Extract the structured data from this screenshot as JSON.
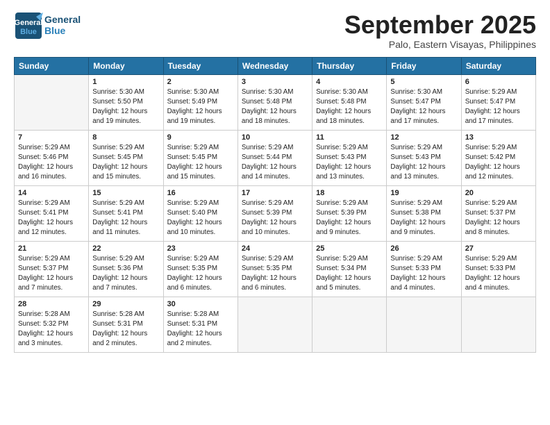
{
  "header": {
    "logo_line1": "General",
    "logo_line2": "Blue",
    "month": "September 2025",
    "location": "Palo, Eastern Visayas, Philippines"
  },
  "weekdays": [
    "Sunday",
    "Monday",
    "Tuesday",
    "Wednesday",
    "Thursday",
    "Friday",
    "Saturday"
  ],
  "weeks": [
    [
      {
        "day": "",
        "info": ""
      },
      {
        "day": "1",
        "info": "Sunrise: 5:30 AM\nSunset: 5:50 PM\nDaylight: 12 hours\nand 19 minutes."
      },
      {
        "day": "2",
        "info": "Sunrise: 5:30 AM\nSunset: 5:49 PM\nDaylight: 12 hours\nand 19 minutes."
      },
      {
        "day": "3",
        "info": "Sunrise: 5:30 AM\nSunset: 5:48 PM\nDaylight: 12 hours\nand 18 minutes."
      },
      {
        "day": "4",
        "info": "Sunrise: 5:30 AM\nSunset: 5:48 PM\nDaylight: 12 hours\nand 18 minutes."
      },
      {
        "day": "5",
        "info": "Sunrise: 5:30 AM\nSunset: 5:47 PM\nDaylight: 12 hours\nand 17 minutes."
      },
      {
        "day": "6",
        "info": "Sunrise: 5:29 AM\nSunset: 5:47 PM\nDaylight: 12 hours\nand 17 minutes."
      }
    ],
    [
      {
        "day": "7",
        "info": "Sunrise: 5:29 AM\nSunset: 5:46 PM\nDaylight: 12 hours\nand 16 minutes."
      },
      {
        "day": "8",
        "info": "Sunrise: 5:29 AM\nSunset: 5:45 PM\nDaylight: 12 hours\nand 15 minutes."
      },
      {
        "day": "9",
        "info": "Sunrise: 5:29 AM\nSunset: 5:45 PM\nDaylight: 12 hours\nand 15 minutes."
      },
      {
        "day": "10",
        "info": "Sunrise: 5:29 AM\nSunset: 5:44 PM\nDaylight: 12 hours\nand 14 minutes."
      },
      {
        "day": "11",
        "info": "Sunrise: 5:29 AM\nSunset: 5:43 PM\nDaylight: 12 hours\nand 13 minutes."
      },
      {
        "day": "12",
        "info": "Sunrise: 5:29 AM\nSunset: 5:43 PM\nDaylight: 12 hours\nand 13 minutes."
      },
      {
        "day": "13",
        "info": "Sunrise: 5:29 AM\nSunset: 5:42 PM\nDaylight: 12 hours\nand 12 minutes."
      }
    ],
    [
      {
        "day": "14",
        "info": "Sunrise: 5:29 AM\nSunset: 5:41 PM\nDaylight: 12 hours\nand 12 minutes."
      },
      {
        "day": "15",
        "info": "Sunrise: 5:29 AM\nSunset: 5:41 PM\nDaylight: 12 hours\nand 11 minutes."
      },
      {
        "day": "16",
        "info": "Sunrise: 5:29 AM\nSunset: 5:40 PM\nDaylight: 12 hours\nand 10 minutes."
      },
      {
        "day": "17",
        "info": "Sunrise: 5:29 AM\nSunset: 5:39 PM\nDaylight: 12 hours\nand 10 minutes."
      },
      {
        "day": "18",
        "info": "Sunrise: 5:29 AM\nSunset: 5:39 PM\nDaylight: 12 hours\nand 9 minutes."
      },
      {
        "day": "19",
        "info": "Sunrise: 5:29 AM\nSunset: 5:38 PM\nDaylight: 12 hours\nand 9 minutes."
      },
      {
        "day": "20",
        "info": "Sunrise: 5:29 AM\nSunset: 5:37 PM\nDaylight: 12 hours\nand 8 minutes."
      }
    ],
    [
      {
        "day": "21",
        "info": "Sunrise: 5:29 AM\nSunset: 5:37 PM\nDaylight: 12 hours\nand 7 minutes."
      },
      {
        "day": "22",
        "info": "Sunrise: 5:29 AM\nSunset: 5:36 PM\nDaylight: 12 hours\nand 7 minutes."
      },
      {
        "day": "23",
        "info": "Sunrise: 5:29 AM\nSunset: 5:35 PM\nDaylight: 12 hours\nand 6 minutes."
      },
      {
        "day": "24",
        "info": "Sunrise: 5:29 AM\nSunset: 5:35 PM\nDaylight: 12 hours\nand 6 minutes."
      },
      {
        "day": "25",
        "info": "Sunrise: 5:29 AM\nSunset: 5:34 PM\nDaylight: 12 hours\nand 5 minutes."
      },
      {
        "day": "26",
        "info": "Sunrise: 5:29 AM\nSunset: 5:33 PM\nDaylight: 12 hours\nand 4 minutes."
      },
      {
        "day": "27",
        "info": "Sunrise: 5:29 AM\nSunset: 5:33 PM\nDaylight: 12 hours\nand 4 minutes."
      }
    ],
    [
      {
        "day": "28",
        "info": "Sunrise: 5:28 AM\nSunset: 5:32 PM\nDaylight: 12 hours\nand 3 minutes."
      },
      {
        "day": "29",
        "info": "Sunrise: 5:28 AM\nSunset: 5:31 PM\nDaylight: 12 hours\nand 2 minutes."
      },
      {
        "day": "30",
        "info": "Sunrise: 5:28 AM\nSunset: 5:31 PM\nDaylight: 12 hours\nand 2 minutes."
      },
      {
        "day": "",
        "info": ""
      },
      {
        "day": "",
        "info": ""
      },
      {
        "day": "",
        "info": ""
      },
      {
        "day": "",
        "info": ""
      }
    ]
  ]
}
